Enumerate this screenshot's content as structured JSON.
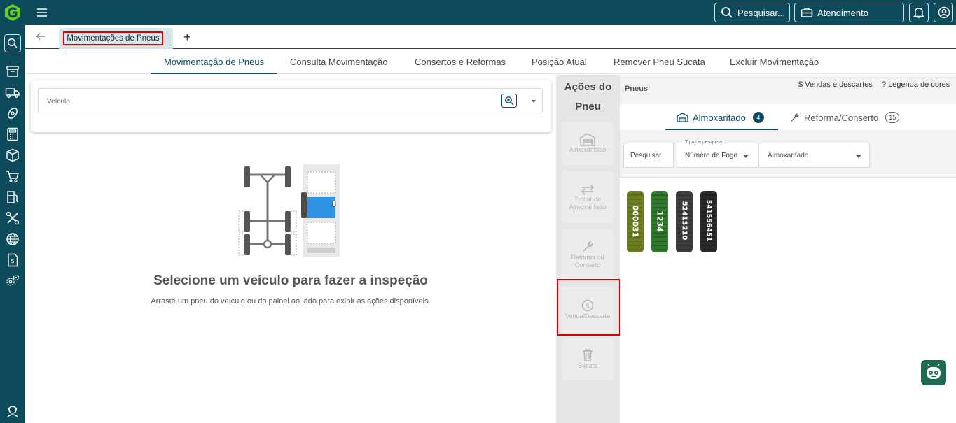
{
  "topbar": {
    "search_label": "Pesquisar...",
    "service_label": "Atendimento",
    "colors": {
      "brand": "#0d4a5c",
      "accent": "#6ad11f",
      "highlight": "#d90000"
    }
  },
  "sidebar": {
    "icons": [
      "search-icon",
      "archive-icon",
      "truck-icon",
      "tire-icon",
      "calculator-icon",
      "box-icon",
      "cart-icon",
      "fuel-icon",
      "tools-icon",
      "globe-icon",
      "invoice-icon",
      "settings-icon",
      "support-icon"
    ]
  },
  "tabs": {
    "active_tab": "Movimentações de Pneus",
    "add_label": "+"
  },
  "subnav": {
    "items": [
      "Movimentação de Pneus",
      "Consulta Movimentação",
      "Consertos e Reformas",
      "Posição Atual",
      "Remover Pneu Sucata",
      "Excluir Movimentação"
    ]
  },
  "vehicle": {
    "label": "Veículo"
  },
  "empty_state": {
    "title": "Selecione um veículo para fazer a inspeção",
    "subtitle": "Arraste um pneu do veículo ou do painel ao lado para exibir as ações disponíveis."
  },
  "actions": {
    "title_line1": "Ações do",
    "title_line2": "Pneu",
    "buttons": [
      {
        "line1": "Almoxarifado",
        "line2": "",
        "icon": "warehouse-icon"
      },
      {
        "line1": "Trocar de",
        "line2": "Almoxarifado",
        "icon": "swap-icon"
      },
      {
        "line1": "Reforma ou",
        "line2": "Conserto",
        "icon": "wrench-icon"
      },
      {
        "line1": "Venda/Descarte",
        "line2": "",
        "icon": "money-icon"
      },
      {
        "line1": "Sucata",
        "line2": "",
        "icon": "trash-icon"
      }
    ]
  },
  "pneus": {
    "title": "Pneus",
    "sales_link": "Vendas e descartes",
    "legend_link": "Legenda de cores",
    "tabs": [
      {
        "label": "Almoxarifado",
        "count": "4"
      },
      {
        "label": "Reforma/Conserto",
        "count": "15"
      }
    ],
    "filters": {
      "search_placeholder": "Pesquisar",
      "type_label": "Tipo de pesquisa",
      "type_value": "Número de Fogo",
      "location_value": "Almoxarifado"
    },
    "tires": [
      {
        "number": "000031",
        "color": "#6b7f1e"
      },
      {
        "number": "1234",
        "color": "#2f7a2a"
      },
      {
        "number": "52413210",
        "color": "#3d3d3d"
      },
      {
        "number": "541556451",
        "color": "#2b2b2b"
      }
    ]
  }
}
